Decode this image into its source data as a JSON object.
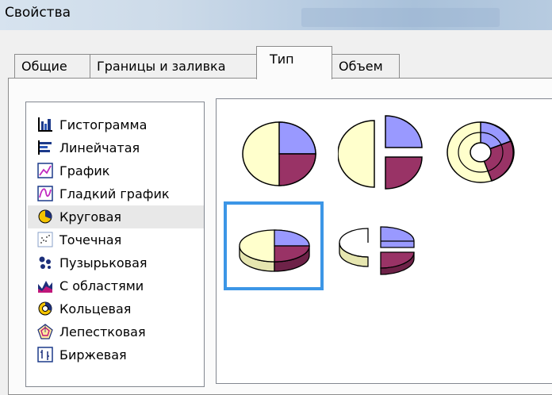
{
  "window": {
    "title": "Свойства"
  },
  "tabs": [
    {
      "label": "Общие"
    },
    {
      "label": "Границы и заливка"
    },
    {
      "label": "Тип"
    },
    {
      "label": "Объем"
    }
  ],
  "chart_types": [
    {
      "label": "Гистограмма",
      "icon": "column-chart-icon"
    },
    {
      "label": "Линейчатая",
      "icon": "bar-chart-icon"
    },
    {
      "label": "График",
      "icon": "line-chart-icon"
    },
    {
      "label": "Гладкий график",
      "icon": "smooth-line-chart-icon"
    },
    {
      "label": "Круговая",
      "icon": "pie-chart-icon",
      "selected": true
    },
    {
      "label": "Точечная",
      "icon": "scatter-chart-icon"
    },
    {
      "label": "Пузырьковая",
      "icon": "bubble-chart-icon"
    },
    {
      "label": "С областями",
      "icon": "area-chart-icon"
    },
    {
      "label": "Кольцевая",
      "icon": "doughnut-chart-icon"
    },
    {
      "label": "Лепестковая",
      "icon": "radar-chart-icon"
    },
    {
      "label": "Биржевая",
      "icon": "stock-chart-icon"
    }
  ],
  "variants": [
    {
      "name": "pie",
      "selected": false
    },
    {
      "name": "exploded-pie",
      "selected": false
    },
    {
      "name": "doughnut",
      "selected": false
    },
    {
      "name": "pie-3d",
      "selected": true
    },
    {
      "name": "exploded-pie-3d",
      "selected": false
    }
  ],
  "colors": {
    "accent": "#3c96e6",
    "slice_blue": "#9999ff",
    "slice_purple": "#993366",
    "slice_cream": "#ffffcc"
  }
}
